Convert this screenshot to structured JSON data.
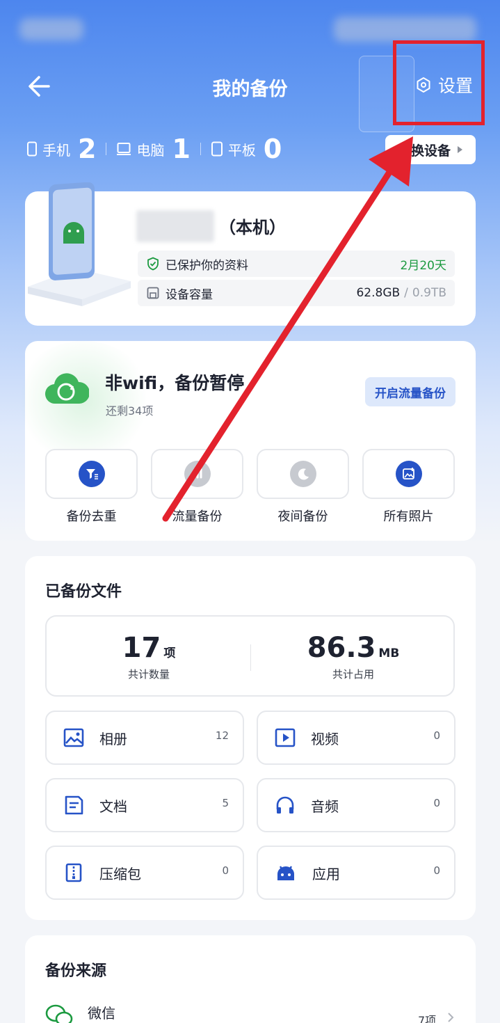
{
  "header": {
    "title": "我的备份",
    "settings_label": "设置"
  },
  "device_counts": [
    {
      "label": "手机",
      "count": "2",
      "icon": "phone-icon"
    },
    {
      "label": "电脑",
      "count": "1",
      "icon": "laptop-icon"
    },
    {
      "label": "平板",
      "count": "0",
      "icon": "tablet-icon"
    }
  ],
  "switch_device_label": "切换设备",
  "device_card": {
    "local_label": "（本机）",
    "protected_label": "已保护你的资料",
    "protected_value": "2月20天",
    "capacity_label": "设备容量",
    "capacity_used": "62.8GB",
    "capacity_divider": "/",
    "capacity_total": "0.9TB"
  },
  "backup_status": {
    "title": "非wifi，备份暂停",
    "subtitle": "还剩34项",
    "open_traffic_button": "开启流量备份",
    "tools": [
      {
        "label": "备份去重",
        "icon": "filter-icon"
      },
      {
        "label": "流量备份",
        "icon": "signal-icon"
      },
      {
        "label": "夜间备份",
        "icon": "moon-icon"
      },
      {
        "label": "所有照片",
        "icon": "photo-add-icon"
      }
    ]
  },
  "files": {
    "title": "已备份文件",
    "total_count": "17",
    "total_count_unit": "项",
    "total_count_label": "共计数量",
    "total_size": "86.3",
    "total_size_unit": "MB",
    "total_size_label": "共计占用",
    "categories": [
      {
        "name": "相册",
        "count": "12",
        "icon": "album-icon"
      },
      {
        "name": "视频",
        "count": "0",
        "icon": "video-icon"
      },
      {
        "name": "文档",
        "count": "5",
        "icon": "document-icon"
      },
      {
        "name": "音频",
        "count": "0",
        "icon": "headphones-icon"
      },
      {
        "name": "压缩包",
        "count": "0",
        "icon": "zip-icon"
      },
      {
        "name": "应用",
        "count": "0",
        "icon": "android-icon"
      }
    ]
  },
  "sources": {
    "title": "备份来源",
    "items": [
      {
        "name": "微信",
        "count": "7项",
        "icon": "wechat-icon"
      }
    ]
  },
  "colors": {
    "accent": "#2653c7",
    "annotation": "#e3222d",
    "success": "#1c9a40"
  }
}
